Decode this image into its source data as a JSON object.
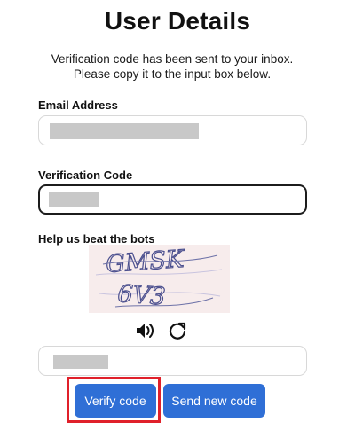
{
  "form": {
    "title": "User Details",
    "intro": "Verification code has been sent to your inbox. Please copy it to the input box below.",
    "email_label": "Email Address",
    "code_label": "Verification Code",
    "captcha_label": "Help us beat the bots",
    "captcha_text": "GMSK 6V3",
    "verify_label": "Verify code",
    "resend_label": "Send new code"
  },
  "icons": {
    "audio": "speaker-icon",
    "refresh": "refresh-icon"
  },
  "colors": {
    "primary_button": "#2f6fd6",
    "highlight_border": "#e0202a",
    "redaction": "#c8c8c8"
  }
}
